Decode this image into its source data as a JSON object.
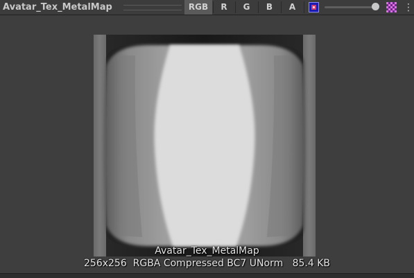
{
  "toolbar": {
    "title": "Avatar_Tex_MetalMap",
    "channels": [
      "RGB",
      "R",
      "G",
      "B",
      "A"
    ],
    "active_channel": "RGB",
    "mip_icon": "mipmap-icon",
    "alpha_icon": "checker-alpha-icon",
    "more_icon": "⋮",
    "mip_level": 1.0
  },
  "preview": {
    "texture_name": "Avatar_Tex_MetalMap",
    "info": "256x256  RGBA Compressed BC7 UNorm   85.4 KB"
  }
}
